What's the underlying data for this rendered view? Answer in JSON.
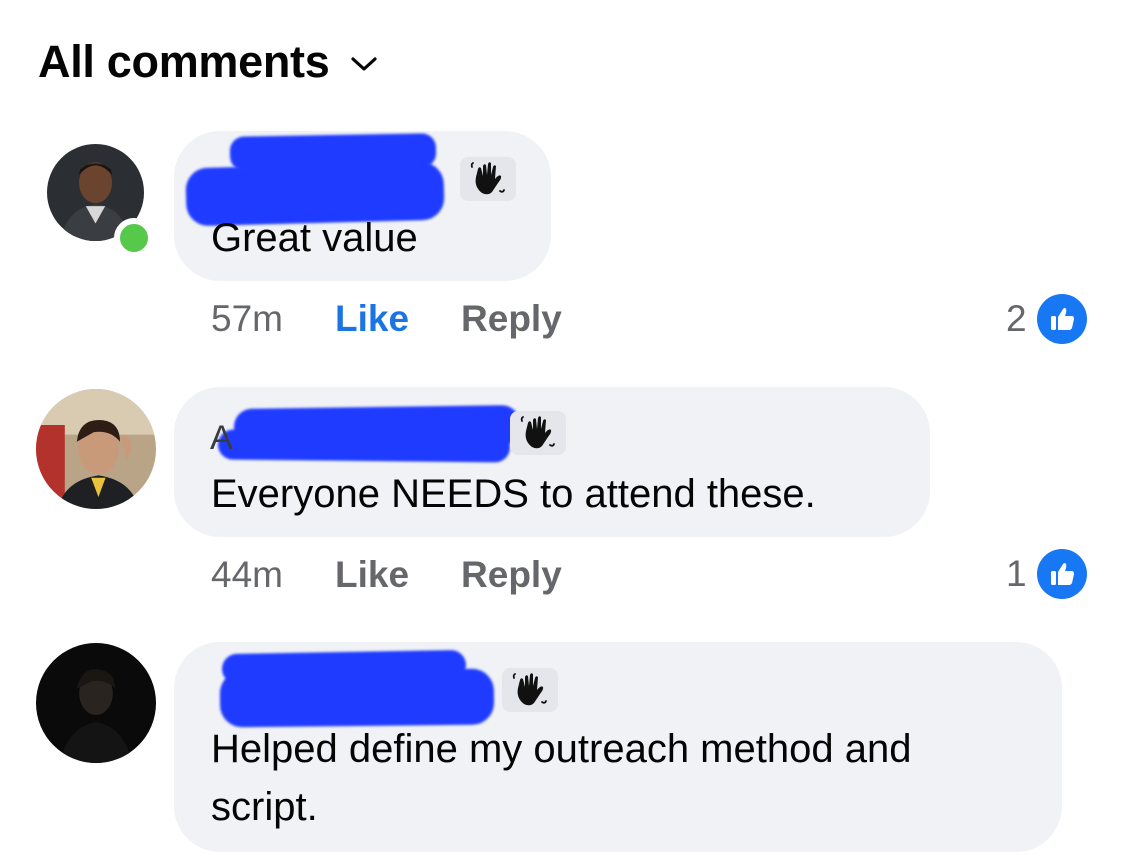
{
  "header": {
    "title": "All comments",
    "chevron_icon": "chevron-down-icon"
  },
  "colors": {
    "bubble": "#f0f2f5",
    "like_active": "#1b74e4",
    "meta_text": "#65676b",
    "presence": "#56c84a",
    "like_badge": "#1877f2"
  },
  "comments": [
    {
      "author_initial": "",
      "author_badge_icon": "wave-icon",
      "text": "Great value",
      "time": "57m",
      "like_label": "Like",
      "liked": true,
      "reply_label": "Reply",
      "reaction_count": "2",
      "reaction_icon": "thumbs-up-icon",
      "online": true
    },
    {
      "author_initial": "A",
      "author_badge_icon": "wave-icon",
      "text": "Everyone NEEDS to attend these.",
      "time": "44m",
      "like_label": "Like",
      "liked": false,
      "reply_label": "Reply",
      "reaction_count": "1",
      "reaction_icon": "thumbs-up-icon",
      "online": false
    },
    {
      "author_initial": "",
      "author_badge_icon": "wave-icon",
      "text": "Helped define my outreach method and\nscript.",
      "online": false
    }
  ]
}
